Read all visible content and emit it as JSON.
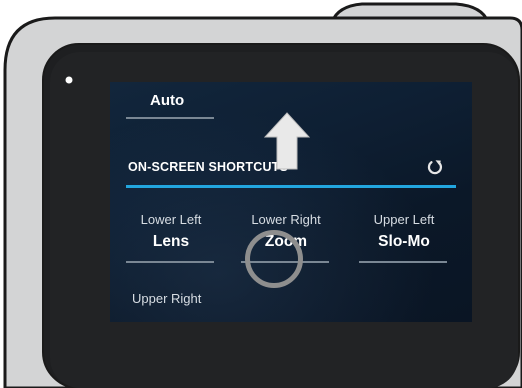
{
  "screen": {
    "previous_setting_value": "Auto",
    "section_title": "ON-SCREEN SHORTCUTS",
    "reset_icon": "reset-icon",
    "shortcuts": [
      {
        "position": "Lower Left",
        "value": "Lens"
      },
      {
        "position": "Lower Right",
        "value": "Zoom"
      },
      {
        "position": "Upper Left",
        "value": "Slo-Mo"
      },
      {
        "position": "Upper Right",
        "value": ""
      }
    ],
    "gesture": {
      "type": "swipe-up",
      "arrow_icon": "up-arrow-icon",
      "touch_indicator": "touch-ring"
    }
  },
  "colors": {
    "accent_divider": "#22a6df",
    "screen_background": "#0e1f33",
    "camera_body": "#d3d4d5",
    "camera_outline": "#1a1a1a"
  }
}
